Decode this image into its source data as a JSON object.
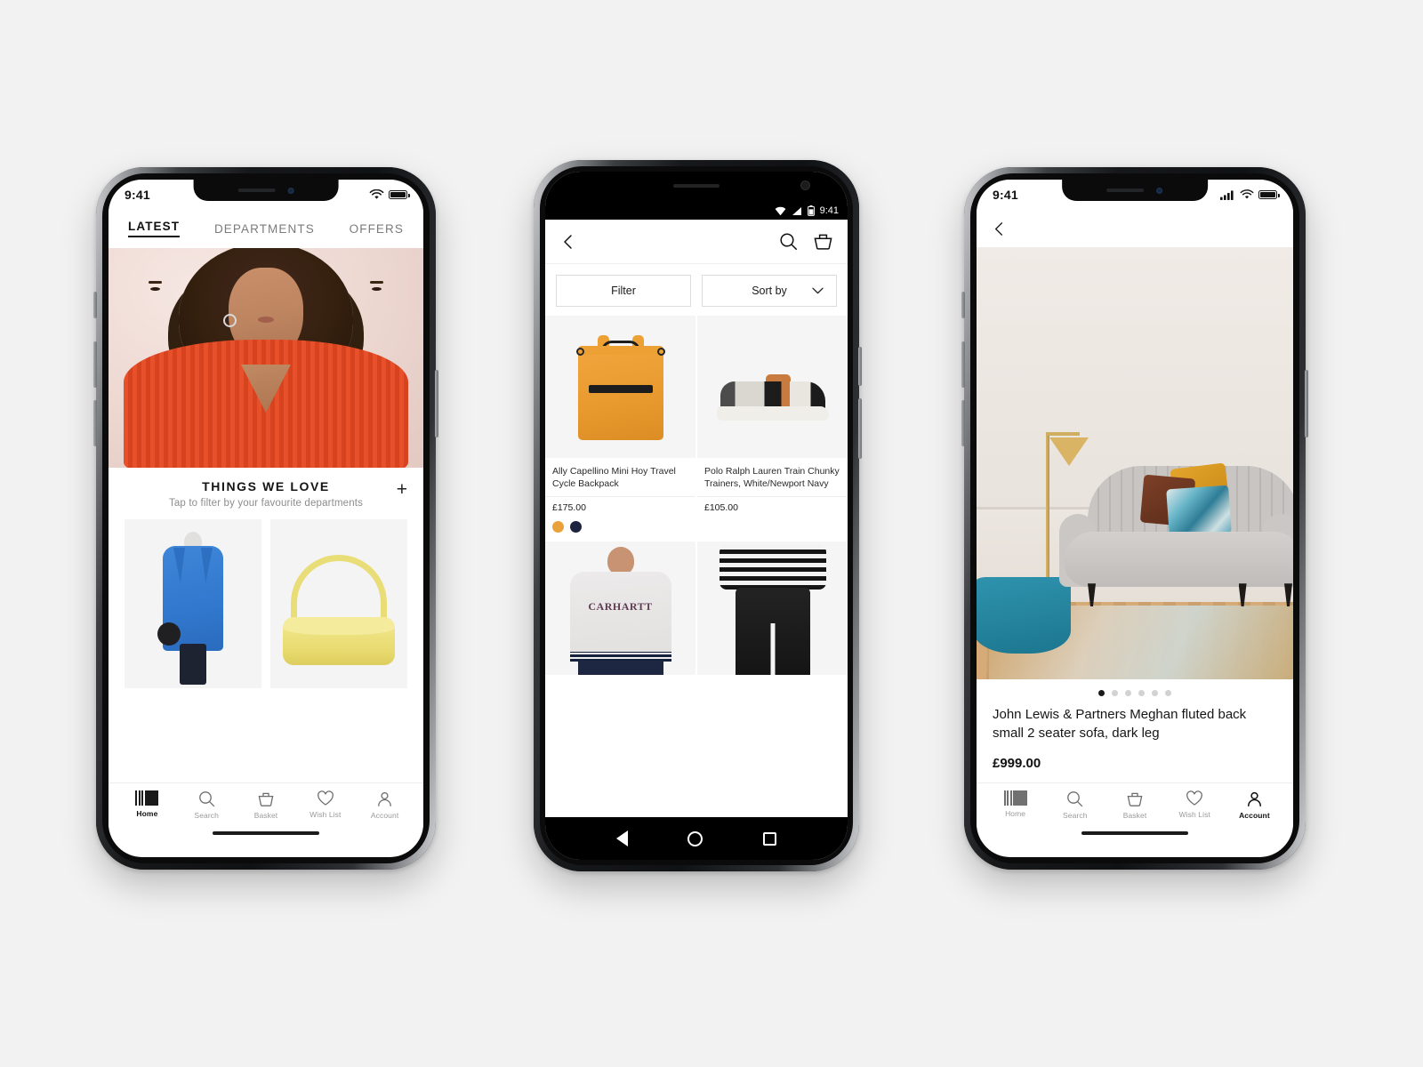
{
  "background_color": "#f2f2f2",
  "phone1": {
    "platform": "ios",
    "status": {
      "time": "9:41",
      "wifi_icon": "wifi-icon",
      "battery_icon": "battery-icon"
    },
    "tabs": [
      {
        "label": "LATEST",
        "active": true
      },
      {
        "label": "DEPARTMENTS",
        "active": false
      },
      {
        "label": "OFFERS",
        "active": false
      }
    ],
    "hero": {
      "name": "hero-banner-woman-orange-jumper"
    },
    "section": {
      "title": "THINGS WE LOVE",
      "subtitle": "Tap to filter by your favourite departments",
      "add_label": "+"
    },
    "cards": [
      {
        "name": "blue-trench-coat"
      },
      {
        "name": "yellow-shoulder-bag"
      }
    ],
    "nav": [
      {
        "label": "Home",
        "icon": "john-lewis-logo-icon",
        "active": true
      },
      {
        "label": "Search",
        "icon": "search-icon",
        "active": false
      },
      {
        "label": "Basket",
        "icon": "basket-icon",
        "active": false
      },
      {
        "label": "Wish List",
        "icon": "heart-icon",
        "active": false
      },
      {
        "label": "Account",
        "icon": "person-icon",
        "active": false
      }
    ]
  },
  "phone2": {
    "platform": "android",
    "status": {
      "time": "9:41",
      "wifi_icon": "wifi-icon",
      "signal_icon": "signal-icon",
      "battery_icon": "battery-icon"
    },
    "appbar": {
      "back_icon": "back-chevron-icon",
      "search_icon": "search-icon",
      "basket_icon": "basket-icon"
    },
    "controls": {
      "filter_label": "Filter",
      "sort_label": "Sort by",
      "sort_chevron_icon": "chevron-down-icon"
    },
    "products": [
      {
        "name": "Ally Capellino Mini Hoy Travel Cycle Backpack",
        "price": "£175.00",
        "image": "orange-backpack",
        "swatches": [
          "#e9a23b",
          "#1d2441"
        ]
      },
      {
        "name": "Polo Ralph Lauren Train Chunky Trainers, White/Newport Navy",
        "price": "£105.00",
        "image": "chunky-trainer",
        "swatches": []
      },
      {
        "name": "",
        "price": "",
        "image": "carhartt-grey-sweatshirt",
        "swatches": []
      },
      {
        "name": "",
        "price": "",
        "image": "striped-top-black-trousers",
        "swatches": []
      }
    ],
    "navbar": {
      "back_icon": "android-back-icon",
      "home_icon": "android-home-icon",
      "recents_icon": "android-recents-icon"
    }
  },
  "phone3": {
    "platform": "ios",
    "status": {
      "time": "9:41",
      "signal_icon": "signal-icon",
      "wifi_icon": "wifi-icon",
      "battery_icon": "battery-icon"
    },
    "appbar": {
      "back_icon": "back-chevron-icon"
    },
    "gallery": {
      "image": "living-room-grey-sofa",
      "dot_count": 6,
      "active_dot": 1
    },
    "product": {
      "title": "John Lewis & Partners Meghan fluted back small 2 seater sofa, dark leg",
      "price": "£999.00"
    },
    "nav": [
      {
        "label": "Home",
        "icon": "john-lewis-logo-icon",
        "active": false
      },
      {
        "label": "Search",
        "icon": "search-icon",
        "active": false
      },
      {
        "label": "Basket",
        "icon": "basket-icon",
        "active": false
      },
      {
        "label": "Wish List",
        "icon": "heart-icon",
        "active": false
      },
      {
        "label": "Account",
        "icon": "person-icon",
        "active": true
      }
    ]
  }
}
